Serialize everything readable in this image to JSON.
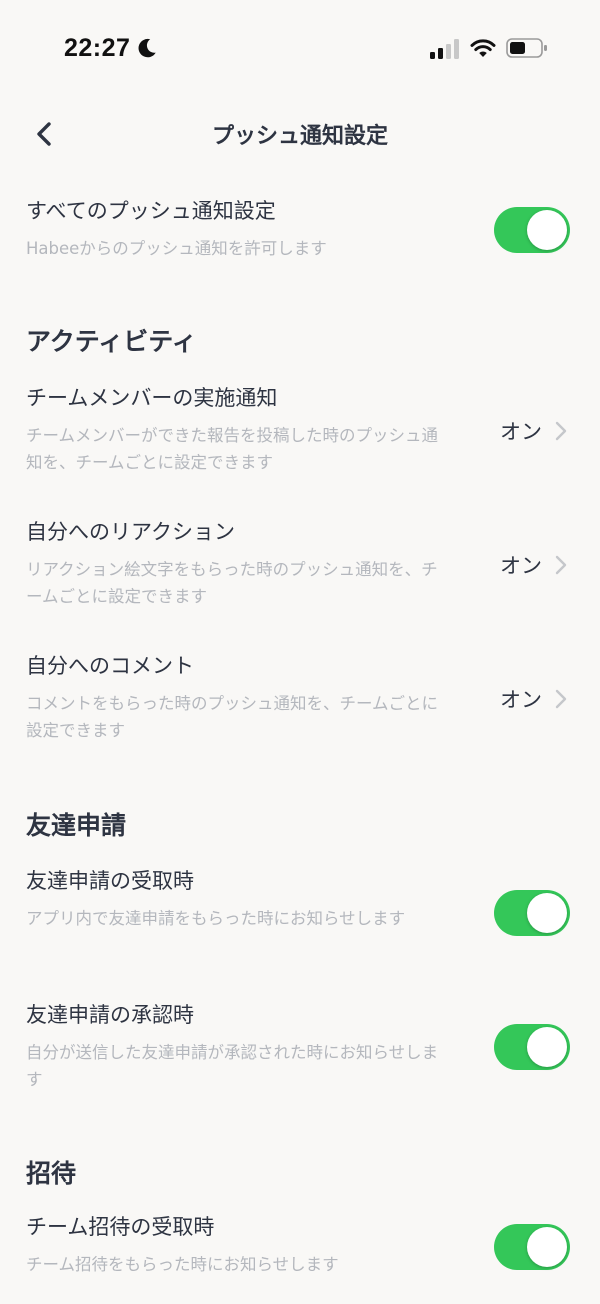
{
  "status_bar": {
    "time": "22:27"
  },
  "nav": {
    "title": "プッシュ通知設定"
  },
  "all_notifications": {
    "title": "すべてのプッシュ通知設定",
    "description": "Habeeからのプッシュ通知を許可します",
    "enabled": true
  },
  "sections": {
    "activity": {
      "title": "アクティビティ",
      "items": [
        {
          "title": "チームメンバーの実施通知",
          "description": "チームメンバーができた報告を投稿した時のプッシュ通知を、チームごとに設定できます",
          "value": "オン"
        },
        {
          "title": "自分へのリアクション",
          "description": "リアクション絵文字をもらった時のプッシュ通知を、チームごとに設定できます",
          "value": "オン"
        },
        {
          "title": "自分へのコメント",
          "description": "コメントをもらった時のプッシュ通知を、チームごとに設定できます",
          "value": "オン"
        }
      ]
    },
    "friend_request": {
      "title": "友達申請",
      "items": [
        {
          "title": "友達申請の受取時",
          "description": "アプリ内で友達申請をもらった時にお知らせします",
          "enabled": true
        },
        {
          "title": "友達申請の承認時",
          "description": "自分が送信した友達申請が承認された時にお知らせします",
          "enabled": true
        }
      ]
    },
    "invite": {
      "title": "招待",
      "items": [
        {
          "title": "チーム招待の受取時",
          "description": "チーム招待をもらった時にお知らせします",
          "enabled": true
        }
      ]
    }
  },
  "colors": {
    "background": "#f9f8f6",
    "text_primary": "#2e3442",
    "text_secondary": "#b4b7bd",
    "toggle_on": "#34c759"
  }
}
